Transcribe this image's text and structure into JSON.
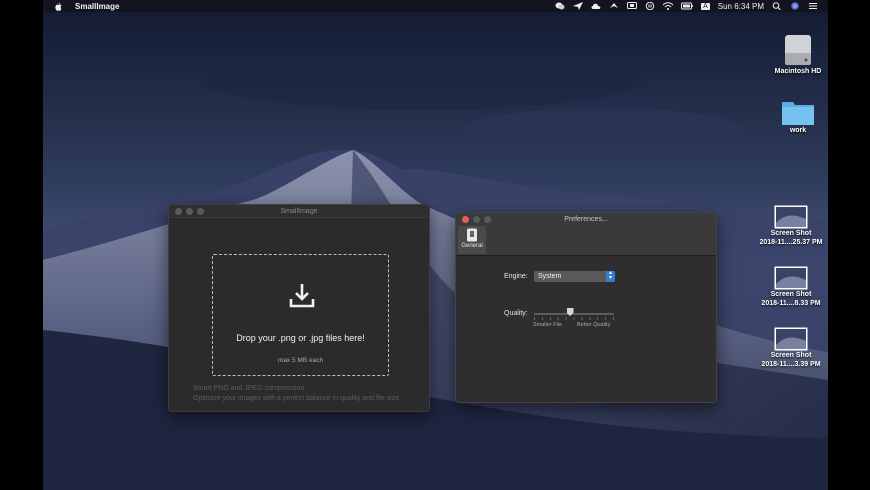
{
  "menubar": {
    "app_name": "SmallImage",
    "clock": "Sun 6:34 PM",
    "input_badge": "A",
    "status_icons": [
      "wechat-icon",
      "paper-plane-icon",
      "cloud-icon",
      "wing-icon",
      "display-icon",
      "pause-icon",
      "wifi-icon",
      "battery-icon",
      "input-source-icon",
      "search-icon",
      "siri-icon",
      "list-icon"
    ]
  },
  "desktop": {
    "items": [
      {
        "label": "Macintosh HD",
        "icon": "hard-drive-icon"
      },
      {
        "label": "work",
        "icon": "folder-icon"
      },
      {
        "label_line1": "Screen Shot",
        "label_line2": "2018-11....25.37 PM",
        "icon": "screenshot-icon"
      },
      {
        "label_line1": "Screen Shot",
        "label_line2": "2018-11....8.33 PM",
        "icon": "screenshot-icon"
      },
      {
        "label_line1": "Screen Shot",
        "label_line2": "2018-11....3.39 PM",
        "icon": "screenshot-icon"
      }
    ]
  },
  "main_window": {
    "title": "SmallImage",
    "drop_text": "Drop your .png or .jpg files here!",
    "drop_subtext": "max 5 MB each",
    "footer_line1": "Smart PNG and JPEG compression",
    "footer_line2": "Optimize your images with a perfect balance in quality and file size.",
    "drop_icon": "download-icon"
  },
  "prefs_window": {
    "title": "Preferences...",
    "tab_label": "General",
    "engine_label": "Engine:",
    "engine_value": "System",
    "quality_label": "Quality:",
    "quality_min_label": "Smaller File",
    "quality_max_label": "Better Quality",
    "quality_level": 0.45
  },
  "colors": {
    "window_bg": "#2b2b2b",
    "accent": "#2f7fd6",
    "close_red": "#ec5f57"
  }
}
